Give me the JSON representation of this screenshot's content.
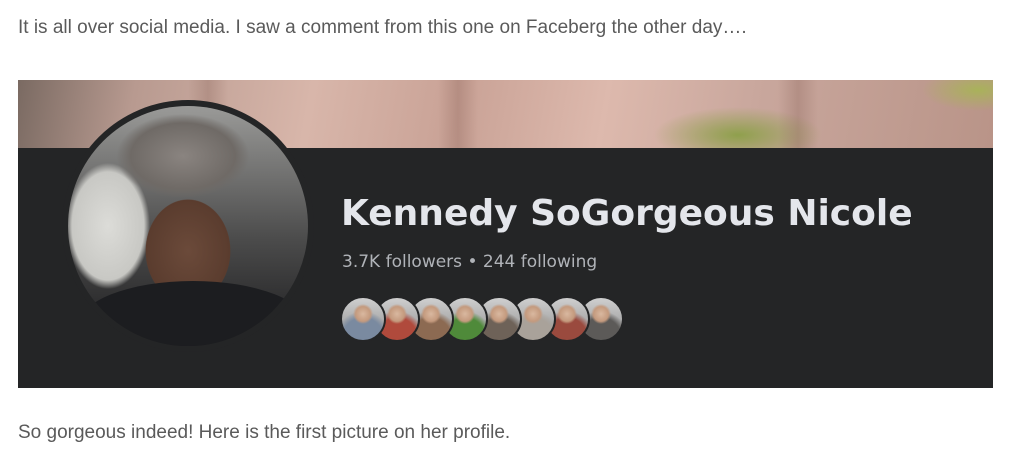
{
  "article": {
    "intro_text": "It is all over social media. I saw a comment from this one on Faceberg the other day….",
    "outro_text": "So gorgeous indeed! Here is the first picture on her profile."
  },
  "profile": {
    "name": "Kennedy SoGorgeous Nicole",
    "followers": "3.7K followers",
    "separator": "•",
    "following": "244 following",
    "friend_avatars": [
      {
        "color": "#7a8aa0"
      },
      {
        "color": "#b04a3c"
      },
      {
        "color": "#8c6a52"
      },
      {
        "color": "#4f8a3a"
      },
      {
        "color": "#6e6258"
      },
      {
        "color": "#a9a29a"
      },
      {
        "color": "#9a4a3e"
      },
      {
        "color": "#5c5a58"
      }
    ]
  },
  "colors": {
    "card_background": "#242526",
    "name_text": "#e4e6eb",
    "secondary_text": "#b0b3b8",
    "article_text": "#5a5a5a"
  }
}
